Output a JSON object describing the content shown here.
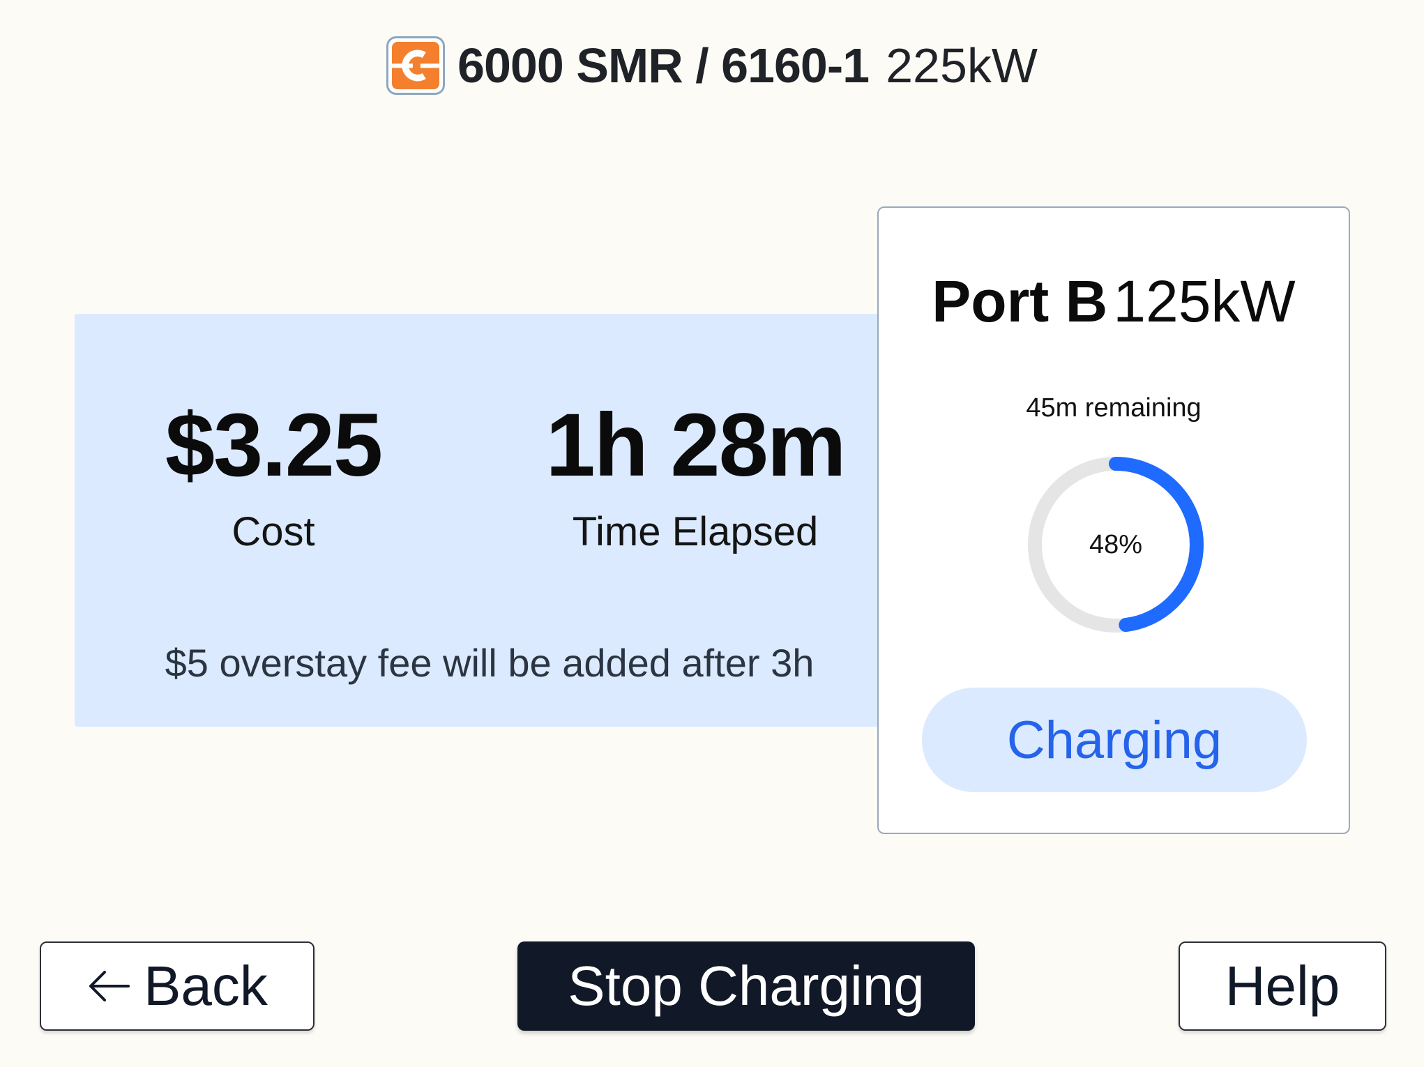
{
  "header": {
    "logo_icon": "chargepoint-logo-icon",
    "station_title": "6000 SMR / 6160-1",
    "station_power": "225kW",
    "brand_color": "#f47f2c"
  },
  "session": {
    "cost_value": "$3.25",
    "cost_label": "Cost",
    "time_value": "1h 28m",
    "time_label": "Time Elapsed",
    "fee_note": "$5 overstay fee will be added after 3h"
  },
  "port": {
    "name": "Port B",
    "power": "125kW",
    "remaining": "45m remaining",
    "progress_label": "48%",
    "progress_fraction": 0.48,
    "status": "Charging",
    "accent_color": "#1f6bff",
    "track_color": "#e5e5e5"
  },
  "actions": {
    "back_label": "Back",
    "back_icon": "arrow-left-icon",
    "stop_label": "Stop Charging",
    "help_label": "Help"
  }
}
